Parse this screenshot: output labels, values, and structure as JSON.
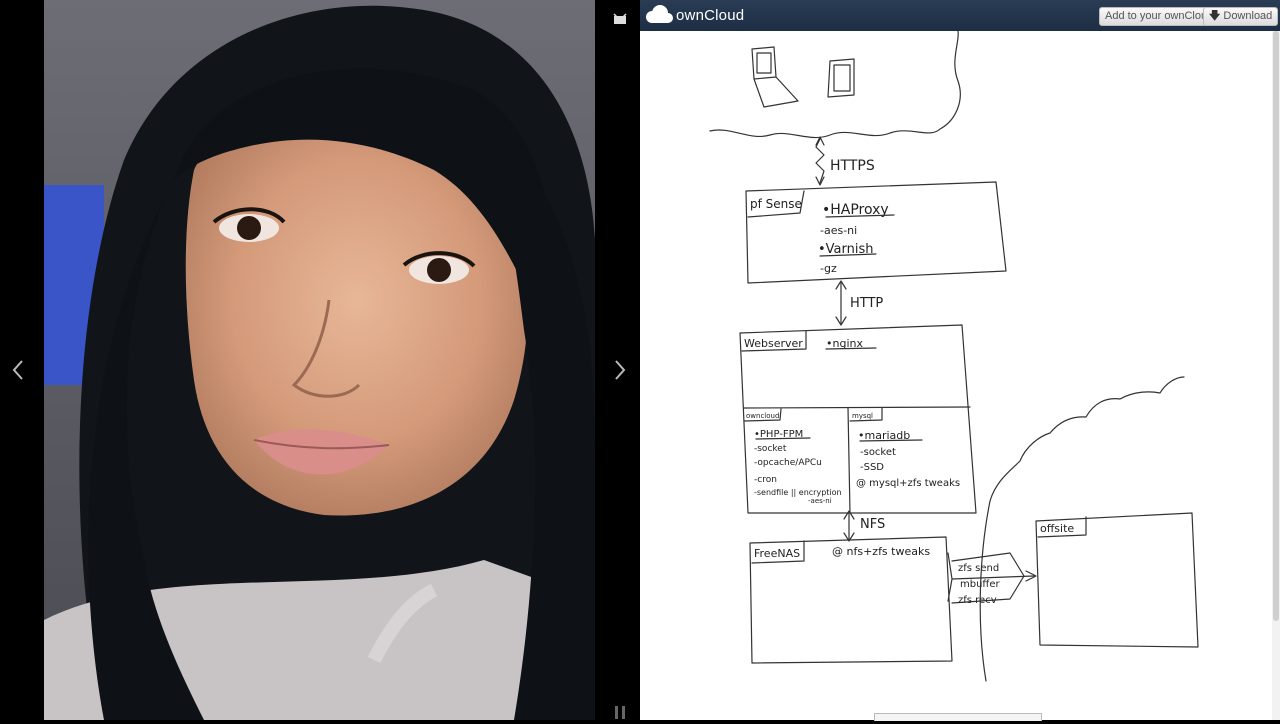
{
  "gallery": {
    "photo_alt": "",
    "controls": {
      "prev": "previous",
      "next": "next",
      "slideshow": "slideshow",
      "pause": "pause"
    }
  },
  "header": {
    "logo_text": "ownCloud",
    "add_button": "Add to your ownCloud",
    "download_button": "Download"
  },
  "diagram": {
    "https_label": "HTTPS",
    "http_label": "HTTP",
    "nfs_label": "NFS",
    "pfsense": {
      "title": "pf Sense",
      "lines": [
        "•HAProxy",
        "-aes-ni",
        "•Varnish",
        "-gz"
      ]
    },
    "webserver": {
      "title": "Webserver",
      "nginx": "•nginx",
      "owncloud": {
        "title": "owncloud",
        "lines": [
          "•PHP-FPM",
          "-socket",
          "-opcache/APCu",
          "-cron",
          "-sendfile || encryption",
          "-aes-ni"
        ]
      },
      "mysql": {
        "title": "mysql",
        "lines": [
          "•mariadb",
          "-socket",
          "-SSD",
          "@ mysql+zfs tweaks"
        ]
      }
    },
    "freenas": {
      "title": "FreeNAS",
      "note": "@ nfs+zfs tweaks"
    },
    "transfer": [
      "zfs send",
      "mbuffer",
      "zfs recv"
    ],
    "offsite": {
      "title": "offsite"
    }
  }
}
